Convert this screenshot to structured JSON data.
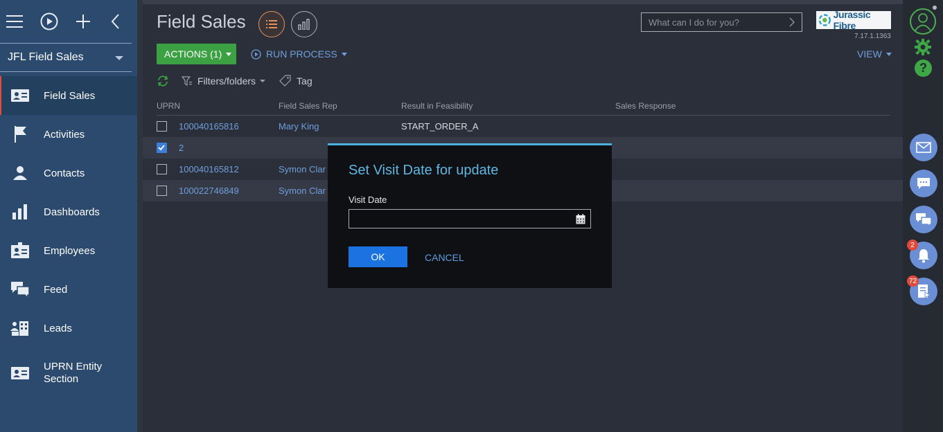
{
  "sidebar": {
    "workspace": "JFL Field Sales",
    "items": [
      {
        "label": "Field Sales",
        "icon": "id-card-icon",
        "active": true
      },
      {
        "label": "Activities",
        "icon": "flag-icon"
      },
      {
        "label": "Contacts",
        "icon": "person-icon"
      },
      {
        "label": "Dashboards",
        "icon": "bar-chart-icon"
      },
      {
        "label": "Employees",
        "icon": "badge-icon"
      },
      {
        "label": "Feed",
        "icon": "chat-bubbles-icon"
      },
      {
        "label": "Leads",
        "icon": "buildings-icon"
      },
      {
        "label": "UPRN Entity",
        "label2": "Section",
        "icon": "id-card-icon"
      }
    ]
  },
  "header": {
    "title": "Field Sales",
    "search_placeholder": "What can I do for you?",
    "logo_text": "Jurassic Fibre",
    "version": "7.17.1.1363",
    "actions_label": "ACTIONS (1)",
    "run_process_label": "RUN PROCESS",
    "view_label": "VIEW"
  },
  "filters": {
    "filters_label": "Filters/folders",
    "tag_label": "Tag"
  },
  "grid": {
    "columns": [
      "UPRN",
      "Field Sales Rep",
      "Result in Feasibility",
      "Sales Response"
    ],
    "rows": [
      {
        "uprn": "100040165816",
        "rep": "Mary King",
        "result": "START_ORDER_A",
        "checked": false
      },
      {
        "uprn": "2",
        "rep": "",
        "result": "",
        "checked": true
      },
      {
        "uprn": "100040165812",
        "rep": "Symon Clar",
        "result": "",
        "checked": false
      },
      {
        "uprn": "100022746849",
        "rep": "Symon Clar",
        "result": "",
        "checked": false
      }
    ]
  },
  "rail": {
    "notifications_badge": "2",
    "tasks_badge": "72"
  },
  "dialog": {
    "title": "Set Visit Date for update",
    "field_label": "Visit Date",
    "field_value": "",
    "ok_label": "OK",
    "cancel_label": "CANCEL"
  },
  "colors": {
    "accent_blue": "#5fb7e4",
    "primary_button": "#1a73e0",
    "actions_green": "#3ba143",
    "sidebar_bg": "#2c4a6e"
  }
}
